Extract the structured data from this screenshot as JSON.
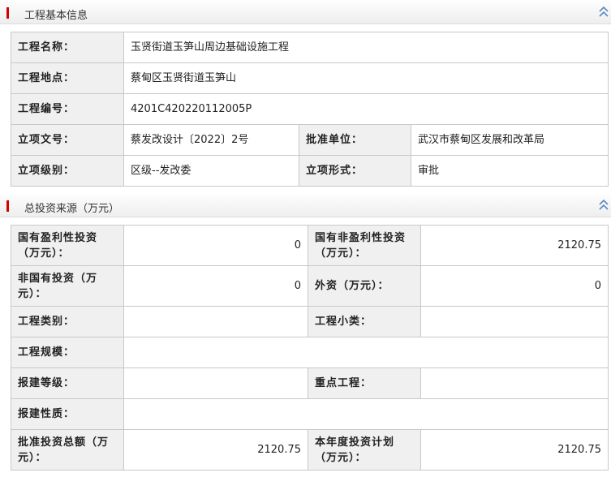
{
  "section1": {
    "title": "工程基本信息",
    "rows": {
      "name_label": "工程名称：",
      "name_value": "玉贤街道玉笋山周边基础设施工程",
      "location_label": "工程地点：",
      "location_value": "蔡甸区玉贤街道玉笋山",
      "code_label": "工程编号：",
      "code_value": "4201C420220112005P",
      "doc_label": "立项文号：",
      "doc_value": "蔡发改设计〔2022〕2号",
      "approver_label": "批准单位：",
      "approver_value": "武汉市蔡甸区发展和改革局",
      "level_label": "立项级别：",
      "level_value": "区级--发改委",
      "form_label": "立项形式：",
      "form_value": "审批"
    }
  },
  "section2": {
    "title": "总投资来源（万元）",
    "rows": {
      "state_profit_label": "国有盈利性投资（万元）：",
      "state_profit_value": "0",
      "state_nonprofit_label": "国有非盈利性投资（万元）：",
      "state_nonprofit_value": "2120.75",
      "nonstate_label": "非国有投资（万元）：",
      "nonstate_value": "0",
      "foreign_label": "外资（万元）：",
      "foreign_value": "0",
      "category_label": "工程类别：",
      "category_value": "",
      "subcategory_label": "工程小类：",
      "subcategory_value": "",
      "scale_label": "工程规模：",
      "scale_value": "",
      "grade_label": "报建等级：",
      "grade_value": "",
      "key_label": "重点工程：",
      "key_value": "",
      "nature_label": "报建性质：",
      "nature_value": "",
      "total_label": "批准投资总额（万元）：",
      "total_value": "2120.75",
      "annual_label": "本年度投资计划（万元）：",
      "annual_value": "2120.75"
    }
  },
  "icons": {
    "collapse": "chevron-double-up-icon"
  },
  "colors": {
    "accent": "#d40000",
    "label_bg": "#f0f0f0",
    "border": "#c8c8c8",
    "collapse_icon": "#5b87c5"
  }
}
